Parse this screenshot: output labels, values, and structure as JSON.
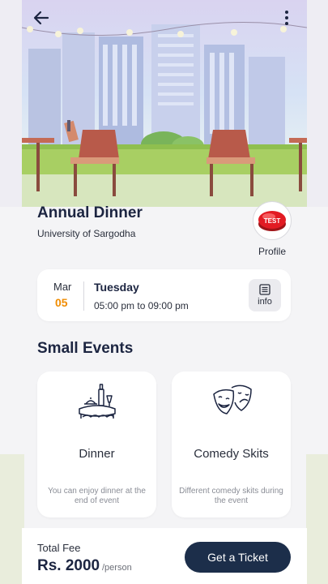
{
  "event": {
    "title": "Annual Dinner",
    "organizer": "University of Sargodha",
    "profile_badge": "TEST",
    "profile_label": "Profile"
  },
  "date": {
    "month": "Mar",
    "day": "05",
    "weekday": "Tuesday",
    "time": "05:00 pm to 09:00 pm",
    "info_label": "info"
  },
  "small_events": {
    "title": "Small Events",
    "items": [
      {
        "name": "Dinner",
        "description": "You can enjoy dinner at the end of event",
        "icon": "dinner-table-icon"
      },
      {
        "name": "Comedy Skits",
        "description": "Different comedy skits during the event",
        "icon": "theater-masks-icon"
      }
    ]
  },
  "footer": {
    "fee_label": "Total Fee",
    "fee_value": "Rs. 2000",
    "fee_unit": "/person",
    "button_label": "Get a Ticket"
  },
  "icons": [
    "back-arrow-icon",
    "more-vert-icon",
    "list-icon"
  ],
  "colors": {
    "primary": "#1c2e4a",
    "accent": "#f08c00",
    "badge_red": "#e21b23"
  }
}
